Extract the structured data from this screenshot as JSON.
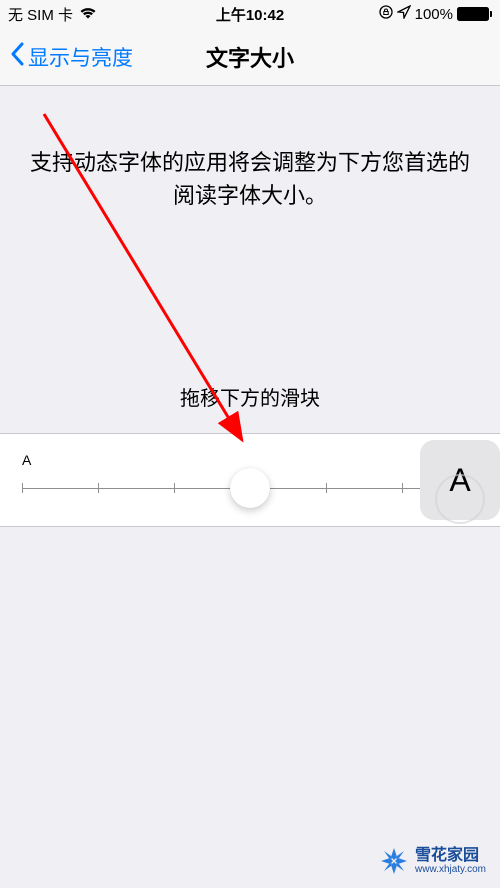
{
  "status_bar": {
    "carrier": "无 SIM 卡",
    "time": "上午10:42",
    "battery_pct": "100%"
  },
  "nav": {
    "back_label": "显示与亮度",
    "title": "文字大小"
  },
  "content": {
    "description": "支持动态字体的应用将会调整为下方您首选的阅读字体大小。",
    "slider_instruction": "拖移下方的滑块",
    "small_a": "A",
    "large_a": "A"
  },
  "slider": {
    "steps": 7,
    "value_index": 3
  },
  "watermark": {
    "name": "雪花家园",
    "url": "www.xhjaty.com"
  }
}
